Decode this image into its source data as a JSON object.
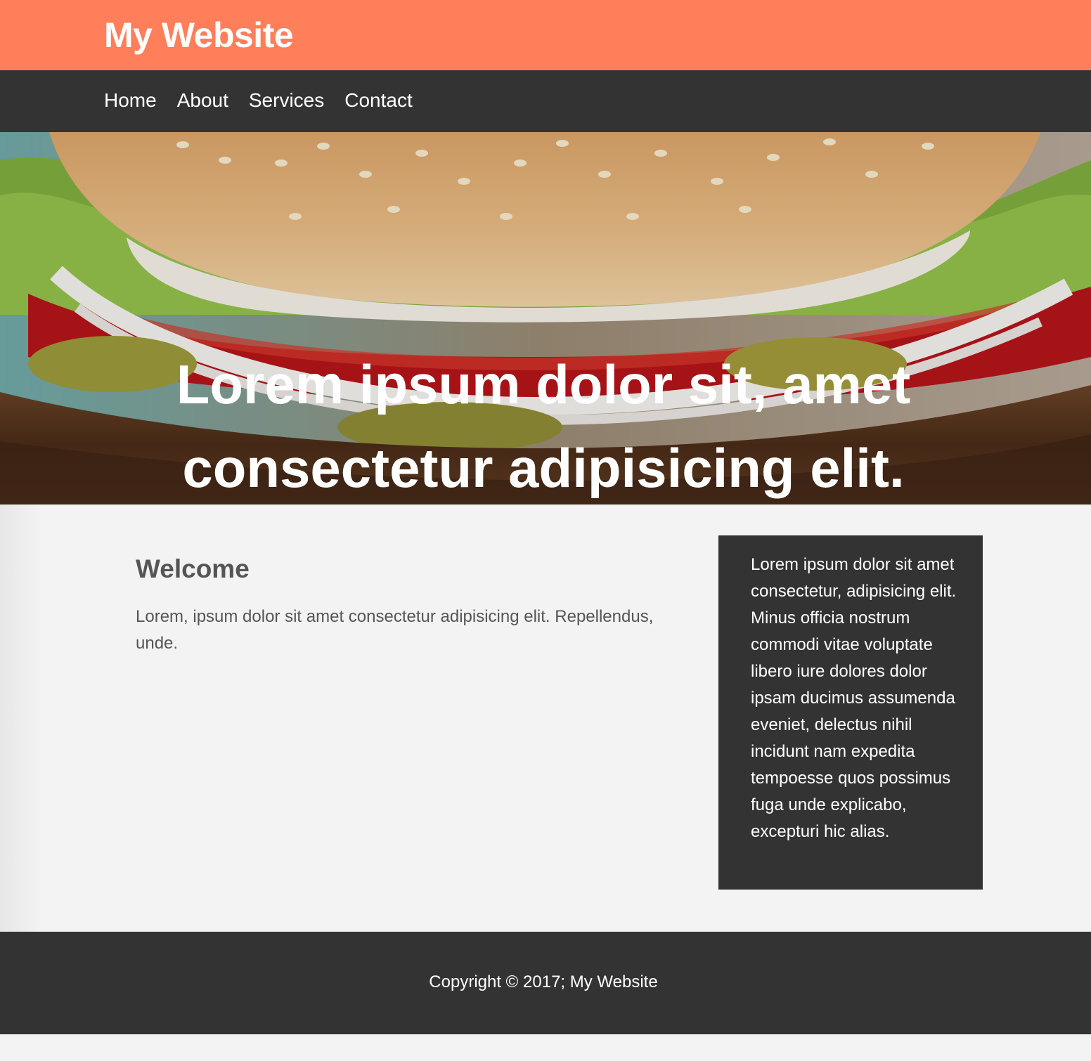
{
  "header": {
    "title": "My Website"
  },
  "nav": {
    "items": [
      {
        "label": "Home"
      },
      {
        "label": "About"
      },
      {
        "label": "Services"
      },
      {
        "label": "Contact"
      }
    ]
  },
  "hero": {
    "heading": "Lorem ipsum dolor sit, amet consectetur adipisicing elit. Adipisci, tempora.",
    "background_image": "burger-photo"
  },
  "main": {
    "welcome_heading": "Welcome",
    "welcome_text": "Lorem, ipsum dolor sit amet consectetur adipisicing elit. Repellendus, unde."
  },
  "sidebar": {
    "text": "Lorem ipsum dolor sit amet consectetur, adipisicing elit. Minus officia nostrum commodi vitae voluptate libero iure dolores dolor ipsam ducimus assumenda eveniet, delectus nihil incidunt nam expedita tempoesse quos possimus fuga unde explicabo, excepturi hic alias."
  },
  "footer": {
    "copyright": "Copyright © 2017; My Website"
  },
  "colors": {
    "header_bg": "#ff7f5a",
    "dark_bg": "#333333",
    "page_bg": "#f3f3f3",
    "body_text": "#555555"
  }
}
